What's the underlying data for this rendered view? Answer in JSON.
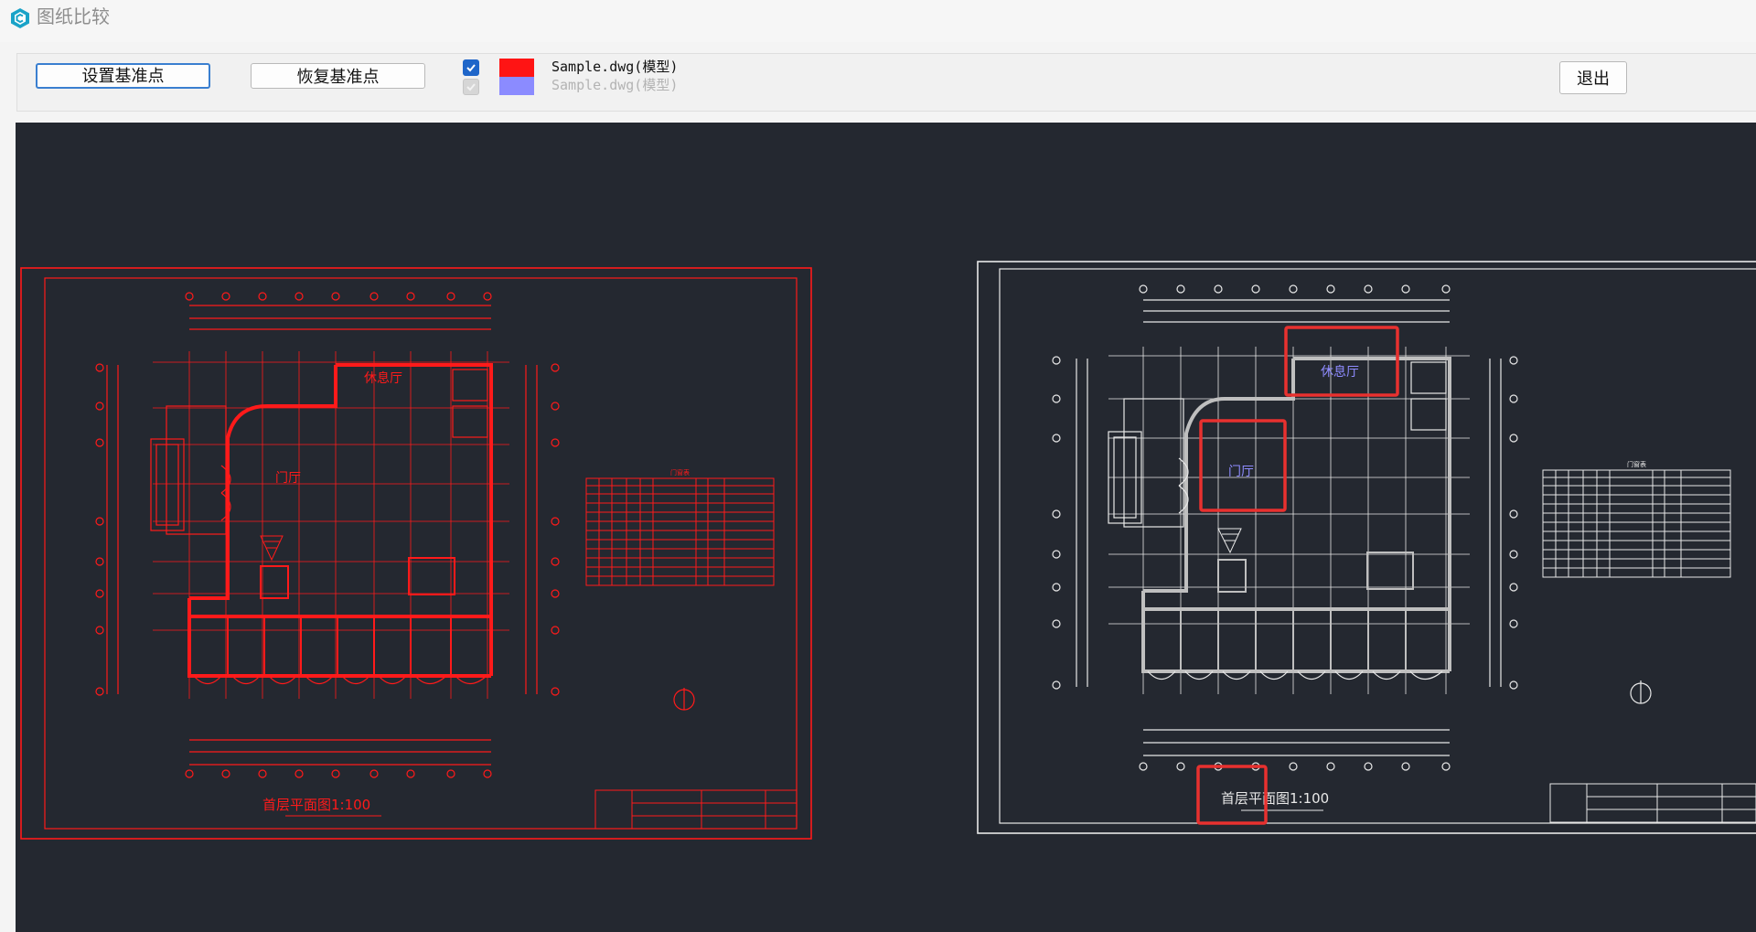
{
  "window": {
    "title": "图纸比较",
    "icon": "app-logo-icon"
  },
  "toolbar": {
    "set_base_point_label": "设置基准点",
    "restore_base_point_label": "恢复基准点",
    "exit_label": "退出",
    "layers": [
      {
        "name": "Sample.dwg(模型)",
        "checked": true,
        "color": "#ff1414"
      },
      {
        "name": "Sample.dwg(模型)",
        "checked": false,
        "color": "#8b8bff"
      }
    ]
  },
  "viewport": {
    "background": "#242830",
    "left_drawing": {
      "color": "#ff1a1a",
      "labels": {
        "lobby": "门厅",
        "lounge": "休息厅",
        "plan_title": "首层平面图1:100",
        "door_table_title": "门窗表"
      }
    },
    "right_drawing": {
      "color": "#e8e8e8",
      "labels": {
        "lobby": "门厅",
        "lounge": "休息厅",
        "plan_title": "首层平面图1:100",
        "door_table_title": "门窗表"
      },
      "highlight_color": "#e8312f"
    }
  }
}
